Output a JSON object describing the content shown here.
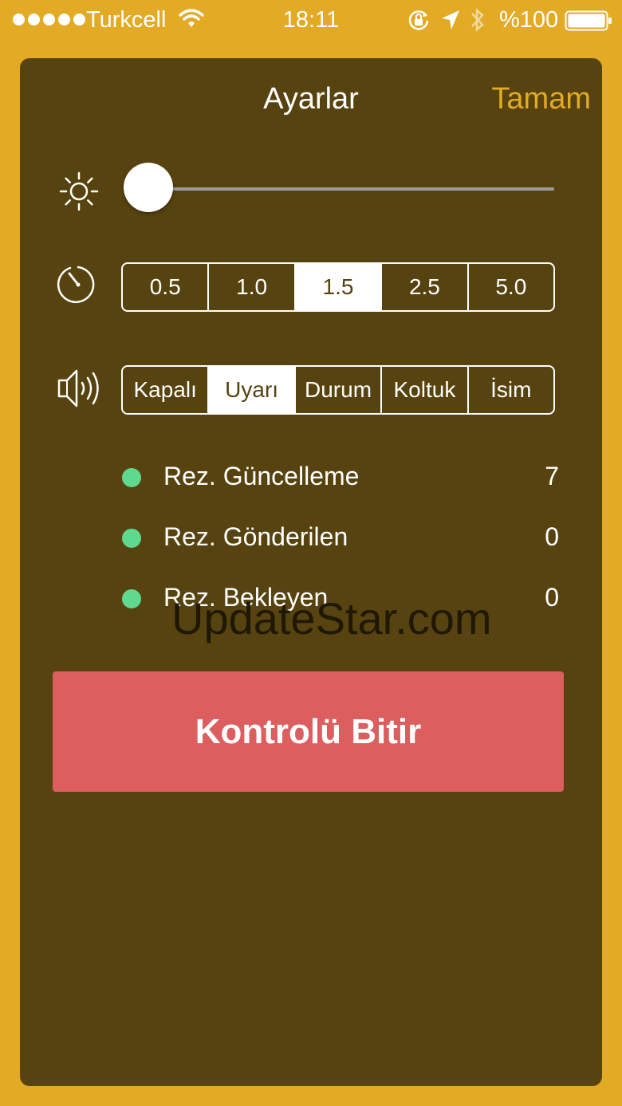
{
  "status_bar": {
    "carrier": "Turkcell",
    "time": "18:11",
    "battery": "%100"
  },
  "header": {
    "title": "Ayarlar",
    "done_label": "Tamam"
  },
  "brightness": {
    "icon": "sun-icon",
    "level": 0.0
  },
  "interval": {
    "icon": "timer-icon",
    "options": [
      "0.5",
      "1.0",
      "1.5",
      "2.5",
      "5.0"
    ],
    "selected": "1.5"
  },
  "sound": {
    "icon": "speaker-icon",
    "options": [
      "Kapalı",
      "Uyarı",
      "Durum",
      "Koltuk",
      "İsim"
    ],
    "selected": "Uyarı"
  },
  "stats": [
    {
      "label": "Rez. Güncelleme",
      "value": "7",
      "color": "#5FD98E"
    },
    {
      "label": "Rez. Gönderilen",
      "value": "0",
      "color": "#5FD98E"
    },
    {
      "label": "Rez. Bekleyen",
      "value": "0",
      "color": "#5FD98E"
    }
  ],
  "finish_label": "Kontrolü Bitir",
  "watermark": "UpdateStar.com",
  "colors": {
    "background": "#E2AA25",
    "panel": "#57430F",
    "accent": "#E2AA25",
    "button": "#DC5E5E",
    "status_dot": "#5FD98E"
  }
}
